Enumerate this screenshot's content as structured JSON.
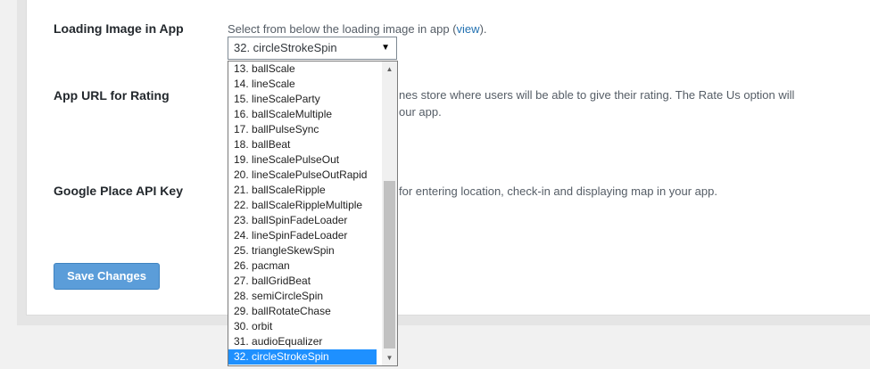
{
  "loading_image": {
    "label": "Loading Image in App",
    "description_text": "Select from below the loading image in app (",
    "view_link": "view",
    "description_end": ").",
    "selected_value": "32. circleStrokeSpin"
  },
  "app_url": {
    "label": "App URL for Rating",
    "description_line1": "nes store where users will be able to give their rating. The Rate Us option will",
    "description_line2": "our app."
  },
  "google_api": {
    "label": "Google Place API Key",
    "description": "for entering location, check-in and displaying map in your app."
  },
  "save_button": {
    "label": "Save Changes"
  },
  "dropdown": {
    "options": [
      "13. ballScale",
      "14. lineScale",
      "15. lineScaleParty",
      "16. ballScaleMultiple",
      "17. ballPulseSync",
      "18. ballBeat",
      "19. lineScalePulseOut",
      "20. lineScalePulseOutRapid",
      "21. ballScaleRipple",
      "22. ballScaleRippleMultiple",
      "23. ballSpinFadeLoader",
      "24. lineSpinFadeLoader",
      "25. triangleSkewSpin",
      "26. pacman",
      "27. ballGridBeat",
      "28. semiCircleSpin",
      "29. ballRotateChase",
      "30. orbit",
      "31. audioEqualizer",
      "32. circleStrokeSpin"
    ],
    "selected_index": 19,
    "scroll_up_icon": "triangle-up-icon",
    "scroll_down_icon": "triangle-down-icon"
  },
  "colors": {
    "accent": "#1e90ff",
    "button": "#5b9dd9",
    "link": "#2271b1"
  }
}
